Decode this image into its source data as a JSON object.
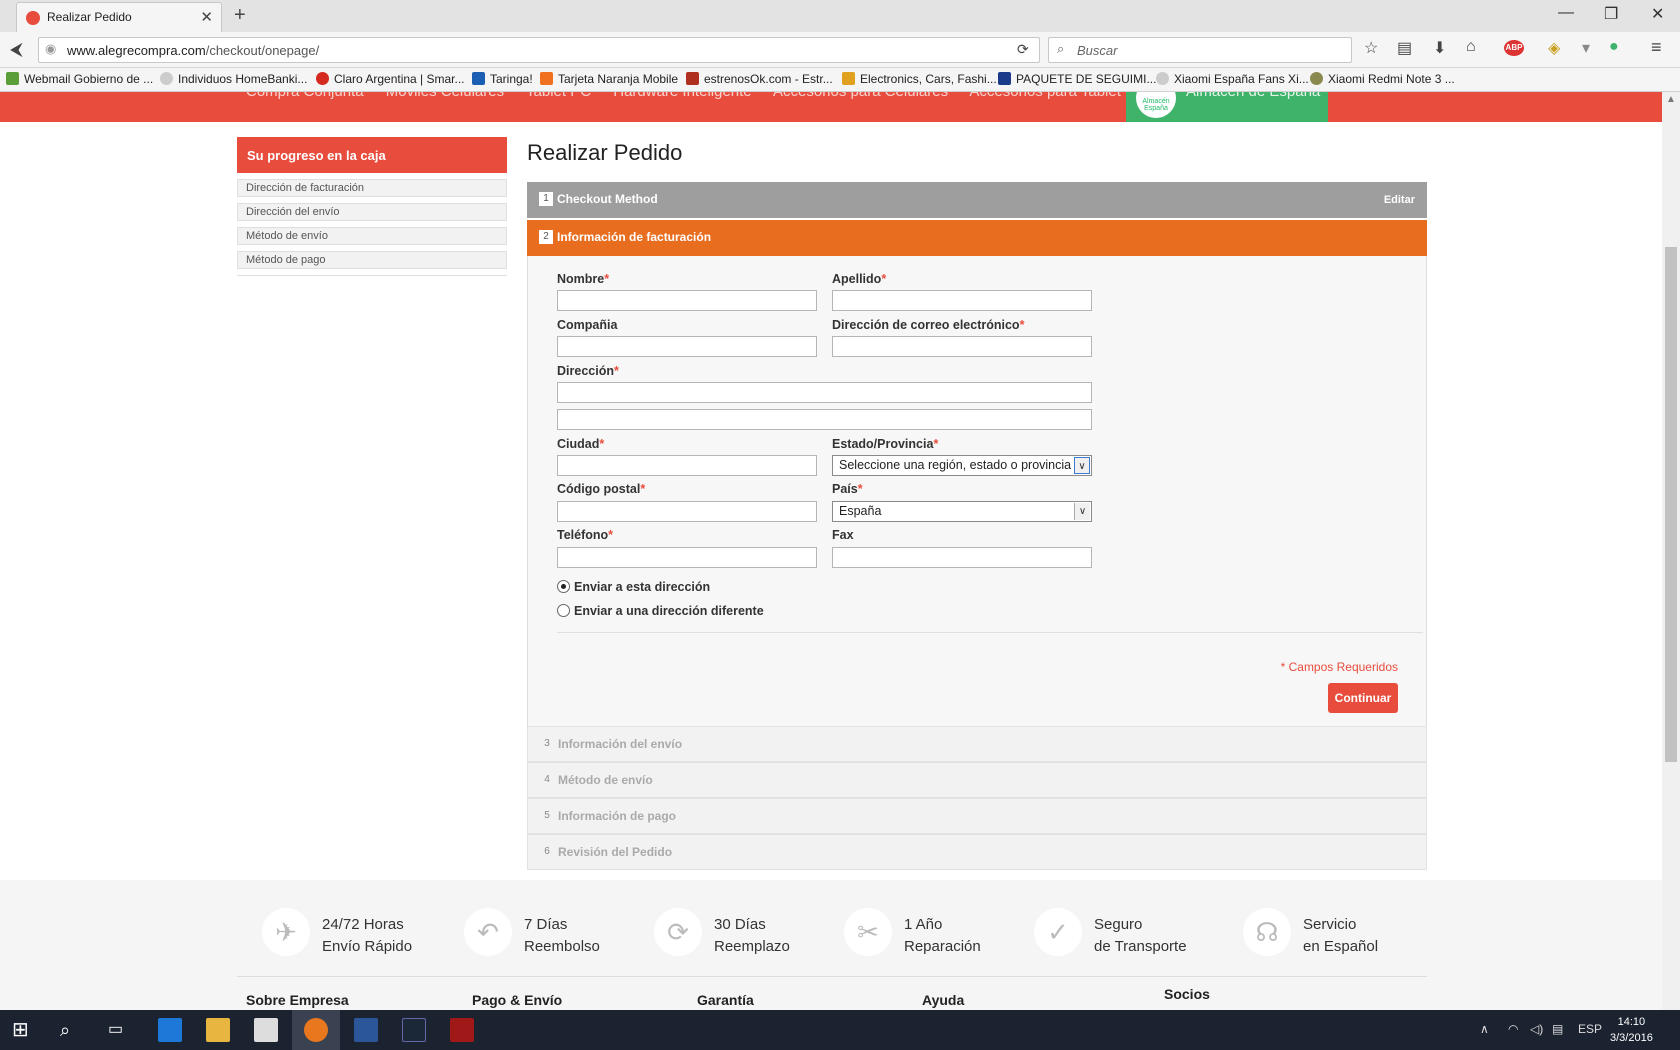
{
  "browser": {
    "tab_title": "Realizar Pedido",
    "url_host": "www.alegrecompra.com",
    "url_path": "/checkout/onepage/",
    "search_placeholder": "Buscar",
    "bookmarks": [
      "Webmail Gobierno de ...",
      "Individuos HomeBanki...",
      "Claro Argentina | Smar...",
      "Taringa!",
      "Tarjeta Naranja Mobile",
      "estrenosOk.com - Estr...",
      "Electronics, Cars, Fashi...",
      "PAQUETE DE SEGUIMI...",
      "Xiaomi España Fans Xi...",
      "Xiaomi Redmi Note 3 ..."
    ]
  },
  "topnav": {
    "items": [
      "Compra Conjunta",
      "Móviles Celulares",
      "Tablet PC",
      "Hardware Inteligente",
      "Accesorios para Celulares",
      "Accesorios para Tablet PC"
    ],
    "green_item": "Almacén de España",
    "logo_text": "Almacén España"
  },
  "sidebar": {
    "title": "Su progreso en la caja",
    "items": [
      "Dirección de facturación",
      "Dirección del envío",
      "Método de envío",
      "Método de pago"
    ]
  },
  "page_title": "Realizar Pedido",
  "steps": {
    "s1": {
      "num": "1",
      "label": "Checkout Method",
      "edit": "Editar"
    },
    "s2": {
      "num": "2",
      "label": "Información de facturación"
    },
    "s3": {
      "num": "3",
      "label": "Información del envío"
    },
    "s4": {
      "num": "4",
      "label": "Método de envío"
    },
    "s5": {
      "num": "5",
      "label": "Información de pago"
    },
    "s6": {
      "num": "6",
      "label": "Revisión del Pedido"
    }
  },
  "form": {
    "nombre": "Nombre",
    "apellido": "Apellido",
    "compania": "Compañia",
    "email": "Dirección de correo electrónico",
    "direccion": "Dirección",
    "ciudad": "Ciudad",
    "estado": "Estado/Provincia",
    "estado_value": "Seleccione una región, estado o provincia",
    "cp": "Código postal",
    "pais": "País",
    "pais_value": "España",
    "telefono": "Teléfono",
    "fax": "Fax",
    "radio_same": "Enviar a esta dirección",
    "radio_diff": "Enviar a una dirección diferente",
    "required_note": "* Campos Requeridos",
    "continue": "Continuar",
    "asterisk": "*"
  },
  "features": [
    {
      "l1": "24/72 Horas",
      "l2": "Envío Rápido",
      "icon": "plane-icon"
    },
    {
      "l1": "7 Días",
      "l2": "Reembolso",
      "icon": "return-arrow-icon"
    },
    {
      "l1": "30 Días",
      "l2": "Reemplazo",
      "icon": "refresh-icon"
    },
    {
      "l1": "1 Año",
      "l2": "Reparación",
      "icon": "tools-icon"
    },
    {
      "l1": "Seguro",
      "l2": "de Transporte",
      "icon": "shield-check-icon"
    },
    {
      "l1": "Servicio",
      "l2": "en Español",
      "icon": "headset-icon"
    }
  ],
  "footer_heads": [
    "Sobre Empresa",
    "Pago & Envío",
    "Garantía",
    "Ayuda",
    "Socios"
  ],
  "taskbar": {
    "lang": "ESP",
    "time": "14:10",
    "date": "3/3/2016"
  }
}
